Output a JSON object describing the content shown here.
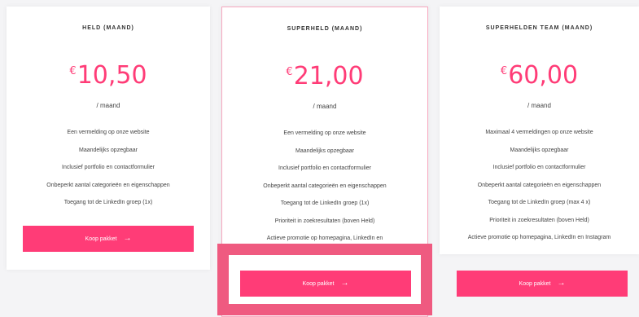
{
  "plans": [
    {
      "title": "HELD (MAAND)",
      "currency": "€",
      "amount": "10,50",
      "period": "/ maand",
      "features": [
        "Een vermelding op onze website",
        "Maandelijks opzegbaar",
        "Inclusief portfolio en contactformulier",
        "Onbeperkt aantal categorieën en eigenschappen",
        "Toegang tot de LinkedIn groep (1x)"
      ],
      "button": "Koop pakket"
    },
    {
      "title": "SUPERHELD (MAAND)",
      "currency": "€",
      "amount": "21,00",
      "period": "/ maand",
      "features": [
        "Een vermelding op onze website",
        "Maandelijks opzegbaar",
        "Inclusief portfolio en contactformulier",
        "Onbeperkt aantal categorieën en eigenschappen",
        "Toegang tot de LinkedIn groep (1x)",
        "Prioriteit in zoekresultaten (boven Held)",
        "Actieve promotie op homepagina, LinkedIn en"
      ],
      "button": "Koop pakket"
    },
    {
      "title": "SUPERHELDEN TEAM (MAAND)",
      "currency": "€",
      "amount": "60,00",
      "period": "/ maand",
      "features": [
        "Maximaal 4 vermeldingen op onze website",
        "Maandelijks opzegbaar",
        "Inclusief portfolio en contactformulier",
        "Onbeperkt aantal categorieën en eigenschappen",
        "Toegang tot de LinkedIn groep (max 4 x)",
        "Prioriteit in zoekresultaten (boven Held)",
        "Actieve promotie op homepagina, LinkedIn en Instagram"
      ],
      "button": "Koop pakket"
    }
  ],
  "icons": {
    "button_arrow": "arrow-right-icon"
  },
  "colors": {
    "accent": "#ff3c77",
    "highlight_border": "#ef5a80",
    "card_border": "#f7a8bf"
  }
}
